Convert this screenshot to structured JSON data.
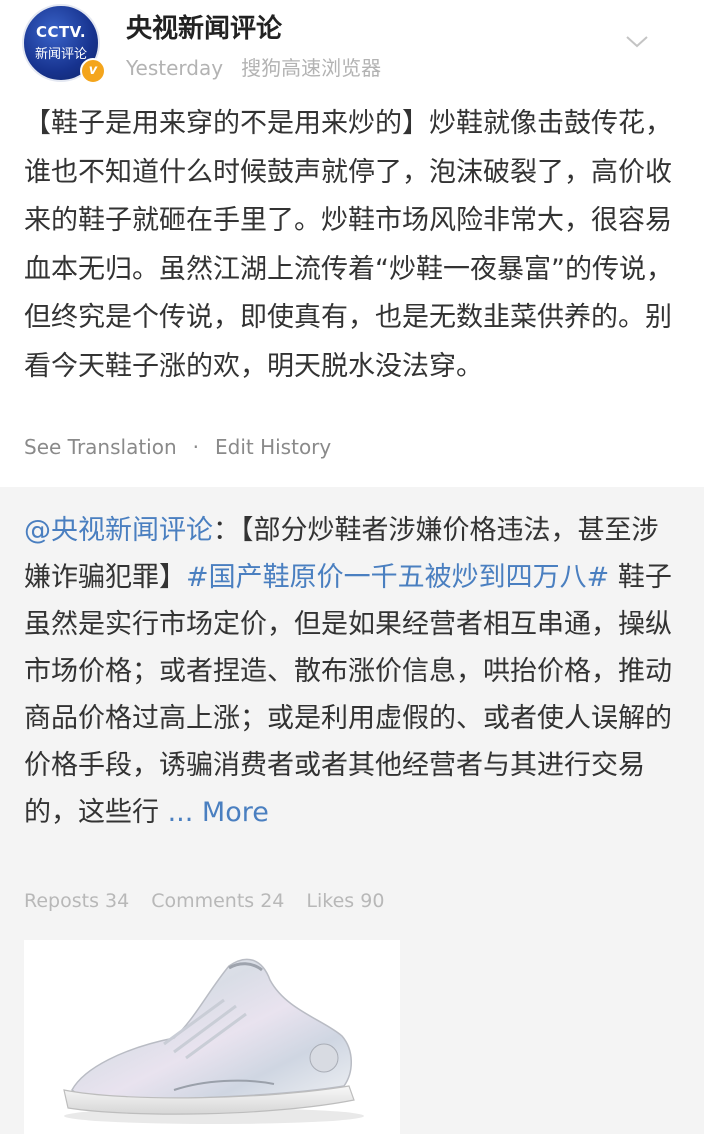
{
  "author": {
    "avatar_text": "CCTV.",
    "avatar_sub": "新闻评论",
    "verified_mark": "v",
    "name": "央视新闻评论",
    "time": "Yesterday",
    "source": "搜狗高速浏览器"
  },
  "post": {
    "text": "【鞋子是用来穿的不是用来炒的】炒鞋就像击鼓传花，谁也不知道什么时候鼓声就停了，泡沫破裂了，高价收来的鞋子就砸在手里了。炒鞋市场风险非常大，很容易血本无归。虽然江湖上流传着“炒鞋一夜暴富”的传说，但终究是个传说，即使真有，也是无数韭菜供养的。别看今天鞋子涨的欢，明天脱水没法穿。",
    "see_translation": "See Translation",
    "separator": "·",
    "edit_history": "Edit History"
  },
  "repost": {
    "mention": "@央视新闻评论",
    "colon": "：",
    "bracket_title": "【部分炒鞋者涉嫌价格违法，甚至涉嫌诈骗犯罪】",
    "hashtag": "#国产鞋原价一千五被炒到四万八#",
    "body": " 鞋子虽然是实行市场定价，但是如果经营者相互串通，操纵市场价格；或者捏造、散布涨价信息，哄抬价格，推动商品价格过高上涨；或是利用虚假的、或者使人误解的价格手段，诱骗消费者或者其他经营者与其进行交易的，这些行 ",
    "more": "... More",
    "reposts": "Reposts 34",
    "comments": "Comments 24",
    "likes": "Likes 90"
  },
  "icons": {
    "chevron": "chevron-down-icon",
    "shoe_image": "sneaker-photo"
  },
  "colors": {
    "link": "#4a7fc0",
    "repost_bg": "#f4f4f4",
    "verified": "#f4a51c",
    "avatar": "#17338f"
  }
}
